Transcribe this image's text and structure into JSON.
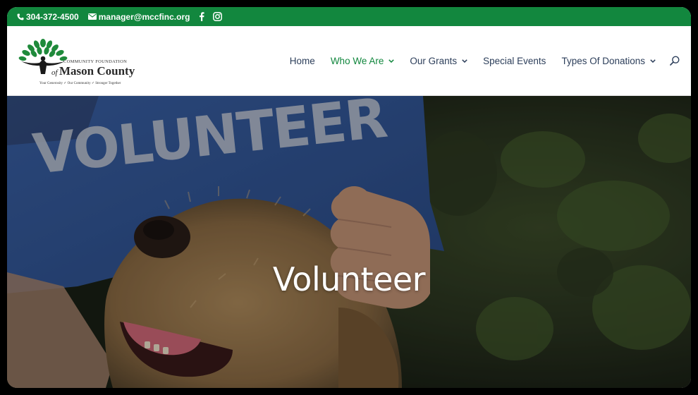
{
  "topbar": {
    "phone": "304-372-4500",
    "email": "manager@mccfinc.org",
    "social": [
      "facebook-icon",
      "instagram-icon"
    ]
  },
  "logo": {
    "line1": "COMMUNITY FOUNDATION",
    "of": "of",
    "line2": "Mason County",
    "tagline": "Your Generosity  ✓  Our Community  ✓  Stronger Together"
  },
  "nav": {
    "items": [
      {
        "label": "Home",
        "dropdown": false
      },
      {
        "label": "Who We Are",
        "dropdown": true,
        "active": true
      },
      {
        "label": "Our Grants",
        "dropdown": true
      },
      {
        "label": "Special Events",
        "dropdown": false
      },
      {
        "label": "Types Of Donations",
        "dropdown": true
      }
    ],
    "search_icon": "search-icon"
  },
  "hero": {
    "title": "Volunteer",
    "shirt_text": "VOLUNTEER"
  },
  "colors": {
    "brand_green": "#12873e",
    "nav_text": "#2c3e5a"
  }
}
